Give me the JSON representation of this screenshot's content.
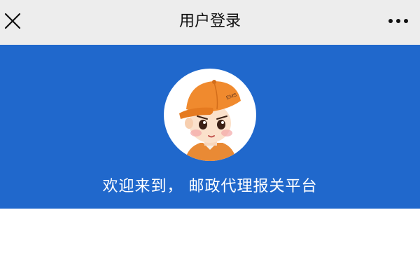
{
  "header": {
    "title": "用户登录",
    "close_icon": "close-icon",
    "more_icon": "more-horizontal-icon"
  },
  "banner": {
    "background_color": "#2068cc",
    "avatar_icon": "avatar-cartoon-mail-carrier",
    "avatar_cap_text": "EMS",
    "welcome_text": "欢迎来到， 邮政代理报关平台"
  },
  "colors": {
    "header_bg": "#ededed",
    "banner_bg": "#2068cc",
    "cap_orange": "#f08a2e"
  }
}
